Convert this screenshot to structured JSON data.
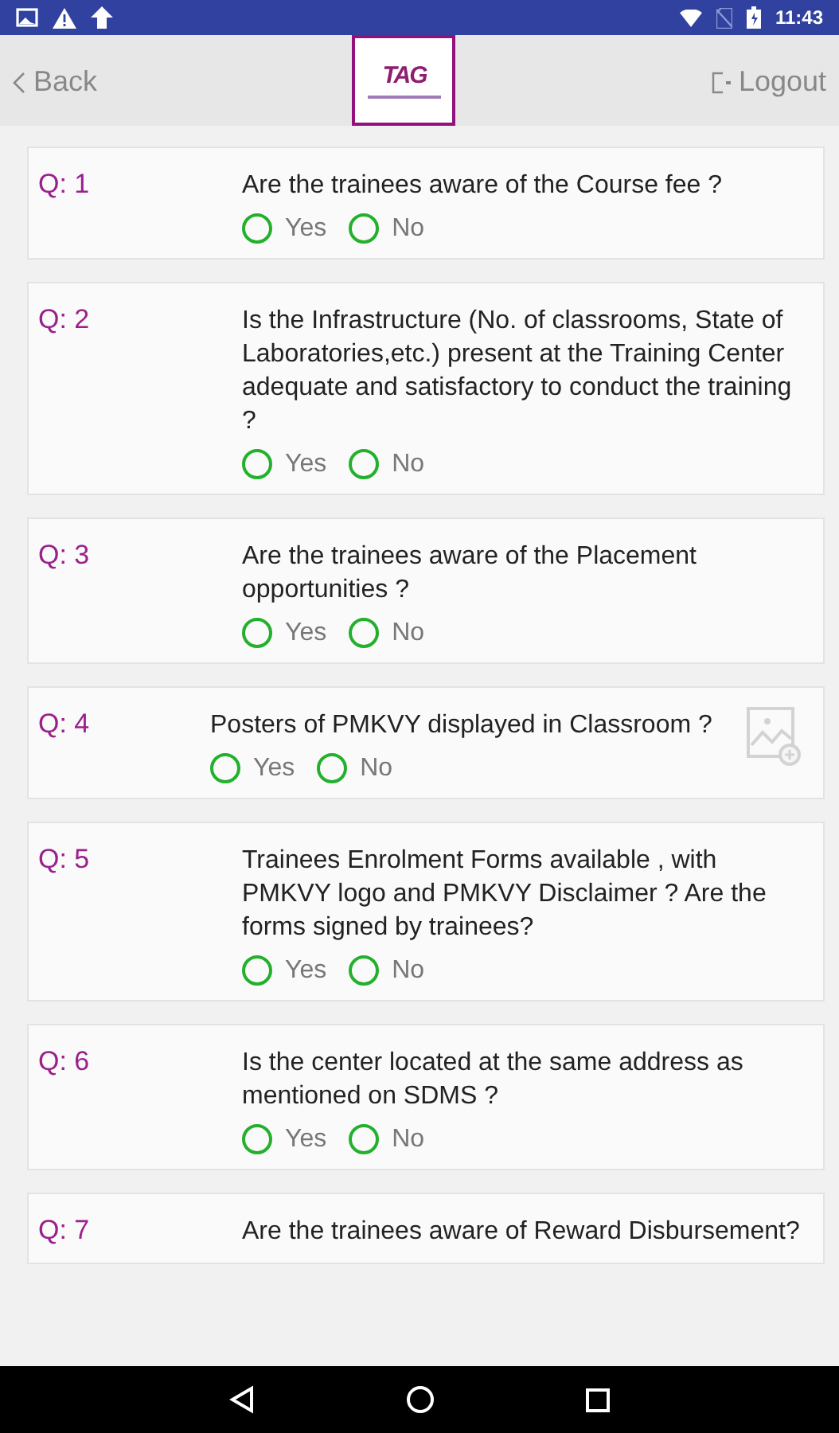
{
  "status_bar": {
    "time": "11:43"
  },
  "header": {
    "back": "Back",
    "logo": "TAG",
    "logout": "Logout"
  },
  "questions": [
    {
      "kind": "plain",
      "label": "Q: 1",
      "text": "Are the trainees aware of the Course fee ?",
      "options": [
        {
          "label": "Yes",
          "selected": false
        },
        {
          "label": "No",
          "selected": false
        }
      ]
    },
    {
      "kind": "plain",
      "label": "Q: 2",
      "text": "Is the Infrastructure (No. of classrooms, State of Laboratories,etc.) present at the Training Center adequate and satisfactory to conduct the training ?",
      "options": [
        {
          "label": "Yes",
          "selected": false
        },
        {
          "label": "No",
          "selected": false
        }
      ]
    },
    {
      "kind": "plain",
      "label": "Q: 3",
      "text": "Are the trainees aware of the Placement opportunities ?",
      "options": [
        {
          "label": "Yes",
          "selected": false
        },
        {
          "label": "No",
          "selected": false
        }
      ]
    },
    {
      "kind": "photo",
      "label": "Q: 4",
      "text": "Posters of PMKVY displayed in Classroom ?",
      "options": [
        {
          "label": "Yes",
          "selected": false
        },
        {
          "label": "No",
          "selected": false
        }
      ]
    },
    {
      "kind": "plain",
      "label": "Q: 5",
      "text": "Trainees Enrolment Forms available , with PMKVY logo and PMKVY Disclaimer ? Are the forms signed by trainees?",
      "options": [
        {
          "label": "Yes",
          "selected": false
        },
        {
          "label": "No",
          "selected": false
        }
      ]
    },
    {
      "kind": "plain",
      "label": "Q: 6",
      "text": "Is the center located at the same address as mentioned on SDMS ?",
      "options": [
        {
          "label": "Yes",
          "selected": false
        },
        {
          "label": "No",
          "selected": false
        }
      ]
    },
    {
      "kind": "plain",
      "label": "Q: 7",
      "text": "Are the trainees aware of Reward Disbursement?"
    }
  ]
}
